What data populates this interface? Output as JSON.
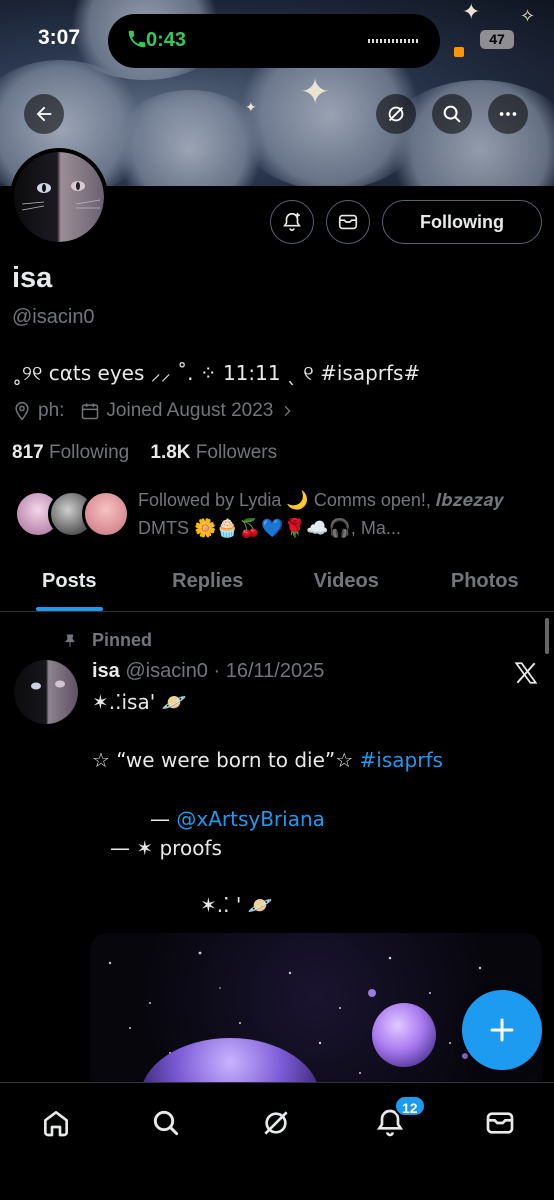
{
  "status_bar": {
    "time": "3:07",
    "call_duration": "0:43",
    "battery": "47",
    "call_color": "#34c759"
  },
  "header": {
    "back_icon": "arrow-left-icon",
    "grok_icon": "grok-icon",
    "search_icon": "search-icon",
    "more_icon": "more-icon"
  },
  "profile": {
    "name": "isa",
    "handle": "@isacin0",
    "bio_text": "˳୨୧ cαts eyes ⸝⸝ ˚. ⁘ 11:11 ˎ ୧ ",
    "bio_tag": "#isaprfs#",
    "location": "ph:",
    "joined": "Joined August 2023",
    "following_count": "817",
    "following_label": "Following",
    "followers_count": "1.8K",
    "followers_label": "Followers",
    "followed_by": "Followed by Lydia 🌙 Comms open!, 𝑰𝒃𝒛𝒆𝒛𝒂𝒚 DMTS 🌼🧁🍒💙🌹☁️🎧, Ma...",
    "following_button": "Following"
  },
  "tabs": [
    "Posts",
    "Replies",
    "Videos",
    "Photos"
  ],
  "post": {
    "pinned_label": "Pinned",
    "author": "isa",
    "meta": "@isacin0 · 16/11/2025",
    "line1": "✶.⁚isa' 🪐",
    "line2_text": "☆ “we were born to die”☆ ",
    "line2_tag": "#isaprfs",
    "line3_prefix": "— ",
    "line3_mention": "@xArtsyBriana",
    "line4": "— ✶ proofs",
    "line5": "✶.⁚ ' 🪐"
  },
  "bottom_nav": {
    "items": [
      "home-icon",
      "search-icon",
      "grok-icon",
      "notifications-icon",
      "messages-icon"
    ],
    "notification_badge": "12"
  },
  "colors": {
    "accent": "#1d9bf0",
    "background": "#000000",
    "text_secondary": "#71767b"
  }
}
